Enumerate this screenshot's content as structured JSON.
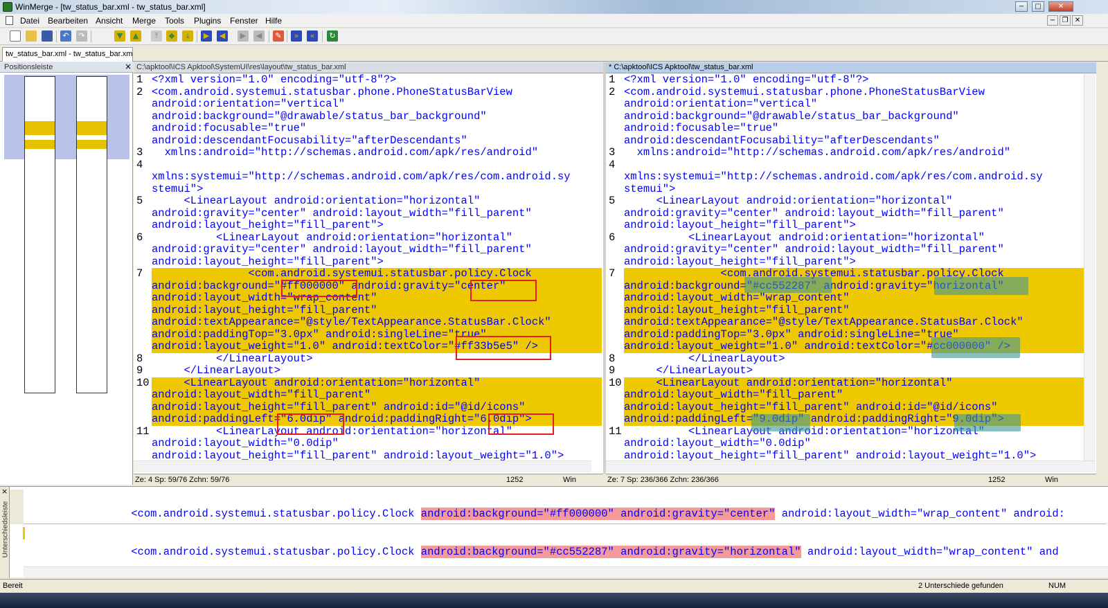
{
  "window": {
    "title": "WinMerge - [tw_status_bar.xml - tw_status_bar.xml]",
    "controls": {
      "minimize": "−",
      "maximize": "□",
      "close": "✕"
    }
  },
  "menu": {
    "items": [
      "Datei",
      "Bearbeiten",
      "Ansicht",
      "Merge",
      "Tools",
      "Plugins",
      "Fenster",
      "Hilfe"
    ],
    "mdi_controls": {
      "minimize": "−",
      "restore": "❐",
      "close": "✕"
    }
  },
  "toolbar": {
    "icons": [
      "new-icon",
      "open-icon",
      "save-icon",
      "undo-icon",
      "redo-icon",
      "next-diff-icon",
      "prev-diff-icon",
      "first-diff-icon",
      "current-diff-icon",
      "last-diff-icon",
      "copy-right-icon",
      "copy-left-icon",
      "copy-right-advance-icon",
      "copy-left-advance-icon",
      "all-right-icon",
      "all-left-icon",
      "options-icon",
      "compare-icon",
      "refresh-icon"
    ]
  },
  "tab": {
    "label": "tw_status_bar.xml - tw_status_bar.xml"
  },
  "location_pane": {
    "title": "Positionsleiste",
    "close": "×"
  },
  "left_pane": {
    "path": "C:\\apktool\\ICS Apktool\\SystemUI\\res\\layout\\tw_status_bar.xml",
    "status": {
      "pos": "Ze: 4  Sp: 59/76  Zchn: 59/76",
      "codepage": "1252",
      "eol": "Win"
    },
    "rows": [
      {
        "n": "1",
        "t": "<?xml version=\"1.0\" encoding=\"utf-8\"?>",
        "d": false
      },
      {
        "n": "2",
        "t": "<com.android.systemui.statusbar.phone.PhoneStatusBarView",
        "d": false
      },
      {
        "n": "",
        "t": "android:orientation=\"vertical\"",
        "d": false
      },
      {
        "n": "",
        "t": "android:background=\"@drawable/status_bar_background\"",
        "d": false
      },
      {
        "n": "",
        "t": "android:focusable=\"true\"",
        "d": false
      },
      {
        "n": "",
        "t": "android:descendantFocusability=\"afterDescendants\"",
        "d": false
      },
      {
        "n": "3",
        "t": "  xmlns:android=\"http://schemas.android.com/apk/res/android\"",
        "d": false
      },
      {
        "n": "4",
        "t": "",
        "d": false
      },
      {
        "n": "",
        "t": "xmlns:systemui=\"http://schemas.android.com/apk/res/com.android.sy",
        "d": false
      },
      {
        "n": "",
        "t": "stemui\">",
        "d": false
      },
      {
        "n": "5",
        "t": "     <LinearLayout android:orientation=\"horizontal\"",
        "d": false
      },
      {
        "n": "",
        "t": "android:gravity=\"center\" android:layout_width=\"fill_parent\"",
        "d": false
      },
      {
        "n": "",
        "t": "android:layout_height=\"fill_parent\">",
        "d": false
      },
      {
        "n": "6",
        "t": "          <LinearLayout android:orientation=\"horizontal\"",
        "d": false
      },
      {
        "n": "",
        "t": "android:gravity=\"center\" android:layout_width=\"fill_parent\"",
        "d": false
      },
      {
        "n": "",
        "t": "android:layout_height=\"fill_parent\">",
        "d": false
      },
      {
        "n": "7",
        "t": "               <com.android.systemui.statusbar.policy.Clock",
        "d": true
      },
      {
        "n": "",
        "t": "android:background=\"#ff000000\" android:gravity=\"center\"",
        "d": true
      },
      {
        "n": "",
        "t": "android:layout_width=\"wrap_content\"",
        "d": true
      },
      {
        "n": "",
        "t": "android:layout_height=\"fill_parent\"",
        "d": true
      },
      {
        "n": "",
        "t": "android:textAppearance=\"@style/TextAppearance.StatusBar.Clock\"",
        "d": true
      },
      {
        "n": "",
        "t": "android:paddingTop=\"3.0px\" android:singleLine=\"true\"",
        "d": true
      },
      {
        "n": "",
        "t": "android:layout_weight=\"1.0\" android:textColor=\"#ff33b5e5\" />",
        "d": true
      },
      {
        "n": "8",
        "t": "          </LinearLayout>",
        "d": false
      },
      {
        "n": "9",
        "t": "     </LinearLayout>",
        "d": false
      },
      {
        "n": "10",
        "t": "     <LinearLayout android:orientation=\"horizontal\"",
        "d": true
      },
      {
        "n": "",
        "t": "android:layout_width=\"fill_parent\"",
        "d": true
      },
      {
        "n": "",
        "t": "android:layout_height=\"fill_parent\" android:id=\"@id/icons\"",
        "d": true
      },
      {
        "n": "",
        "t": "android:paddingLeft=\"6.0dip\" android:paddingRight=\"6.0dip\">",
        "d": true
      },
      {
        "n": "11",
        "t": "          <LinearLayout android:orientation=\"horizontal\"",
        "d": false
      },
      {
        "n": "",
        "t": "android:layout_width=\"0.0dip\"",
        "d": false
      },
      {
        "n": "",
        "t": "android:layout_height=\"fill_parent\" android:layout_weight=\"1.0\">",
        "d": false
      }
    ]
  },
  "right_pane": {
    "path": "* C:\\apktool\\ICS Apktool\\tw_status_bar.xml",
    "status": {
      "pos": "Ze: 7  Sp: 236/366  Zchn: 236/366",
      "codepage": "1252",
      "eol": "Win"
    },
    "rows": [
      {
        "n": "1",
        "t": "<?xml version=\"1.0\" encoding=\"utf-8\"?>",
        "d": false
      },
      {
        "n": "2",
        "t": "<com.android.systemui.statusbar.phone.PhoneStatusBarView",
        "d": false
      },
      {
        "n": "",
        "t": "android:orientation=\"vertical\"",
        "d": false
      },
      {
        "n": "",
        "t": "android:background=\"@drawable/status_bar_background\"",
        "d": false
      },
      {
        "n": "",
        "t": "android:focusable=\"true\"",
        "d": false
      },
      {
        "n": "",
        "t": "android:descendantFocusability=\"afterDescendants\"",
        "d": false
      },
      {
        "n": "3",
        "t": "  xmlns:android=\"http://schemas.android.com/apk/res/android\"",
        "d": false
      },
      {
        "n": "4",
        "t": "",
        "d": false
      },
      {
        "n": "",
        "t": "xmlns:systemui=\"http://schemas.android.com/apk/res/com.android.sy",
        "d": false
      },
      {
        "n": "",
        "t": "stemui\">",
        "d": false
      },
      {
        "n": "5",
        "t": "     <LinearLayout android:orientation=\"horizontal\"",
        "d": false
      },
      {
        "n": "",
        "t": "android:gravity=\"center\" android:layout_width=\"fill_parent\"",
        "d": false
      },
      {
        "n": "",
        "t": "android:layout_height=\"fill_parent\">",
        "d": false
      },
      {
        "n": "6",
        "t": "          <LinearLayout android:orientation=\"horizontal\"",
        "d": false
      },
      {
        "n": "",
        "t": "android:gravity=\"center\" android:layout_width=\"fill_parent\"",
        "d": false
      },
      {
        "n": "",
        "t": "android:layout_height=\"fill_parent\">",
        "d": false
      },
      {
        "n": "7",
        "t": "               <com.android.systemui.statusbar.policy.Clock",
        "d": true
      },
      {
        "n": "",
        "t": "android:background=\"#cc552287\" android:gravity=\"horizontal\"",
        "d": true
      },
      {
        "n": "",
        "t": "android:layout_width=\"wrap_content\"",
        "d": true
      },
      {
        "n": "",
        "t": "android:layout_height=\"fill_parent\"",
        "d": true
      },
      {
        "n": "",
        "t": "android:textAppearance=\"@style/TextAppearance.StatusBar.Clock\"",
        "d": true
      },
      {
        "n": "",
        "t": "android:paddingTop=\"3.0px\" android:singleLine=\"true\"",
        "d": true
      },
      {
        "n": "",
        "t": "android:layout_weight=\"1.0\" android:textColor=\"#cc000000\" />",
        "d": true
      },
      {
        "n": "8",
        "t": "          </LinearLayout>",
        "d": false
      },
      {
        "n": "9",
        "t": "     </LinearLayout>",
        "d": false
      },
      {
        "n": "10",
        "t": "     <LinearLayout android:orientation=\"horizontal\"",
        "d": true
      },
      {
        "n": "",
        "t": "android:layout_width=\"fill_parent\"",
        "d": true
      },
      {
        "n": "",
        "t": "android:layout_height=\"fill_parent\" android:id=\"@id/icons\"",
        "d": true
      },
      {
        "n": "",
        "t": "android:paddingLeft=\"9.0dip\" android:paddingRight=\"9.0dip\">",
        "d": true
      },
      {
        "n": "11",
        "t": "          <LinearLayout android:orientation=\"horizontal\"",
        "d": false
      },
      {
        "n": "",
        "t": "android:layout_width=\"0.0dip\"",
        "d": false
      },
      {
        "n": "",
        "t": "android:layout_height=\"fill_parent\" android:layout_weight=\"1.0\">",
        "d": false
      }
    ]
  },
  "diff_pane": {
    "label": "Unterschiedsleiste",
    "close": "×",
    "left": {
      "pre": "<com.android.systemui.statusbar.policy.Clock ",
      "mark": "android:background=\"#ff000000\" android:gravity=\"center\"",
      "post": " android:layout_width=\"wrap_content\" android:"
    },
    "right": {
      "pre": "<com.android.systemui.statusbar.policy.Clock ",
      "mark": "android:background=\"#cc552287\" android:gravity=\"horizontal\"",
      "post": " android:layout_width=\"wrap_content\" and"
    }
  },
  "statusbar": {
    "left": "Bereit",
    "diffs": "2 Unterschiede gefunden",
    "num": "NUM"
  },
  "colors": {
    "diff_row": "#efc900",
    "annotation_red": "#e02020",
    "annotation_teal": "#3c9696",
    "diff_mark": "#f59a9a"
  }
}
